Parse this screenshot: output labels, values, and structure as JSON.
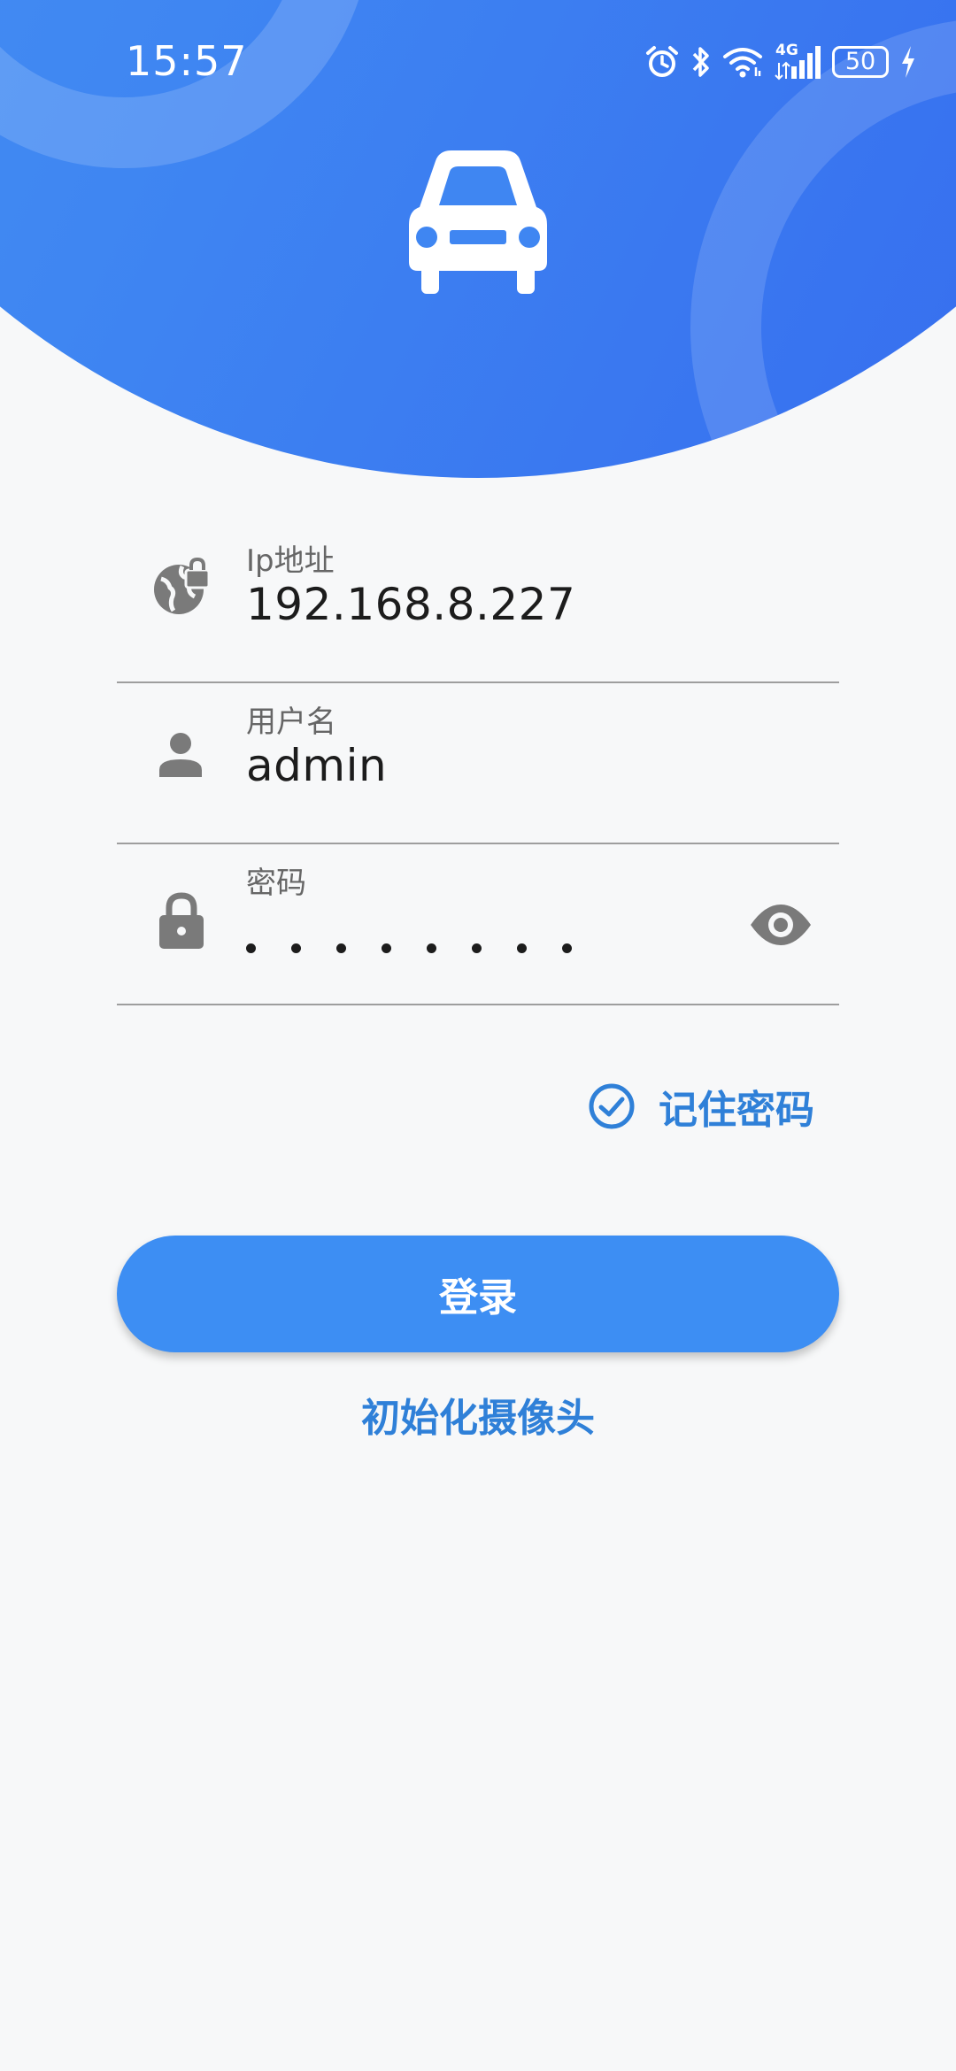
{
  "status_bar": {
    "time": "15:57",
    "network": "4G",
    "battery": "50",
    "icons": [
      "alarm-icon",
      "bluetooth-icon",
      "wifi-icon",
      "signal-icon",
      "battery-icon",
      "charging-icon"
    ]
  },
  "header": {
    "logo_icon": "car-icon"
  },
  "form": {
    "ip": {
      "label": "Ip地址",
      "value": "192.168.8.227",
      "icon": "globe-lock-icon"
    },
    "username": {
      "label": "用户名",
      "value": "admin",
      "icon": "person-icon"
    },
    "password": {
      "label": "密码",
      "masked_length": 8,
      "icon": "lock-icon",
      "toggle_icon": "eye-icon"
    }
  },
  "remember_password": {
    "label": "记住密码",
    "checked": true
  },
  "login_button": {
    "label": "登录"
  },
  "init_camera_link": {
    "label": "初始化摄像头"
  },
  "colors": {
    "header_gradient_start": "#4a97f5",
    "header_gradient_end": "#3468ee",
    "primary_button": "#3d8ef3",
    "accent_text": "#2f80d8",
    "icon_gray": "#7a7a7a",
    "background": "#f7f8f9"
  }
}
